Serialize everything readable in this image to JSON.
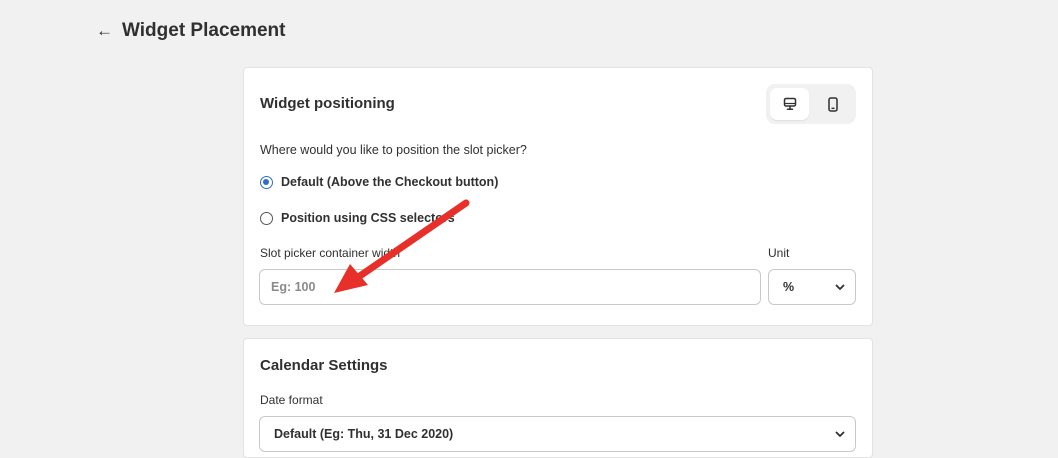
{
  "header": {
    "title": "Widget Placement",
    "back_icon": "←"
  },
  "widget_positioning": {
    "title": "Widget positioning",
    "device_toggle": [
      {
        "name": "desktop",
        "active": true
      },
      {
        "name": "mobile",
        "active": false
      }
    ],
    "question": "Where would you like to position the slot picker?",
    "options": [
      {
        "label": "Default (Above the Checkout button)",
        "checked": true
      },
      {
        "label": "Position using CSS selectors",
        "checked": false
      }
    ],
    "width_field": {
      "label": "Slot picker container width",
      "placeholder": "Eg: 100",
      "value": ""
    },
    "unit_field": {
      "label": "Unit",
      "value": "%"
    }
  },
  "calendar_settings": {
    "title": "Calendar Settings",
    "date_format": {
      "label": "Date format",
      "value": "Default (Eg: Thu, 31 Dec 2020)"
    }
  },
  "colors": {
    "radio_accent": "#2c6ecb",
    "annotation_arrow": "#e8302a",
    "background": "#f1f1f1"
  }
}
